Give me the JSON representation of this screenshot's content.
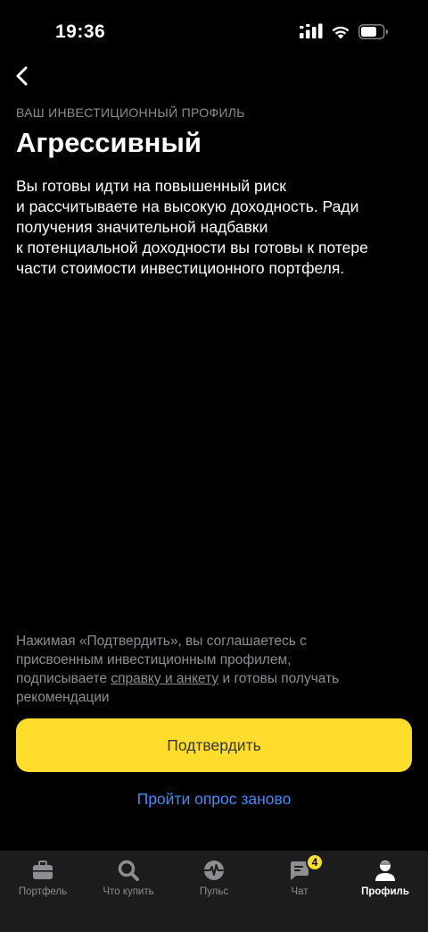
{
  "status_bar": {
    "time": "19:36"
  },
  "header": {
    "eyebrow": "ВАШ ИНВЕСТИЦИОННЫЙ ПРОФИЛЬ",
    "title": "Агрессивный"
  },
  "description_lines": [
    "Вы готовы идти на повышенный риск",
    "и рассчитываете на высокую доходность. Ради",
    "получения значительной надбавки",
    "к потенциальной доходности вы готовы к потере",
    "части стоимости инвестиционного портфеля."
  ],
  "consent": {
    "line1": "Нажимая «Подтвердить», вы соглашаетесь с",
    "line2": "присвоенным инвестиционным профилем,",
    "line3_prefix": "подписываете ",
    "line3_link": "справку и анкету",
    "line3_suffix": " и готовы получать",
    "line4": "рекомендации"
  },
  "actions": {
    "confirm_label": "Подтвердить",
    "retake_label": "Пройти опрос заново"
  },
  "tab_bar": {
    "tabs": [
      {
        "label": "Портфель",
        "icon": "briefcase-icon"
      },
      {
        "label": "Что купить",
        "icon": "search-icon"
      },
      {
        "label": "Пульс",
        "icon": "pulse-icon"
      },
      {
        "label": "Чат",
        "icon": "chat-icon",
        "badge": "4"
      },
      {
        "label": "Профиль",
        "icon": "profile-icon",
        "active": true
      }
    ]
  },
  "colors": {
    "background": "#000000",
    "accent_yellow": "#ffdd2d",
    "link_blue": "#428bf9",
    "secondary_text": "#8d8d92",
    "tab_bar": "#1c1c1e"
  }
}
